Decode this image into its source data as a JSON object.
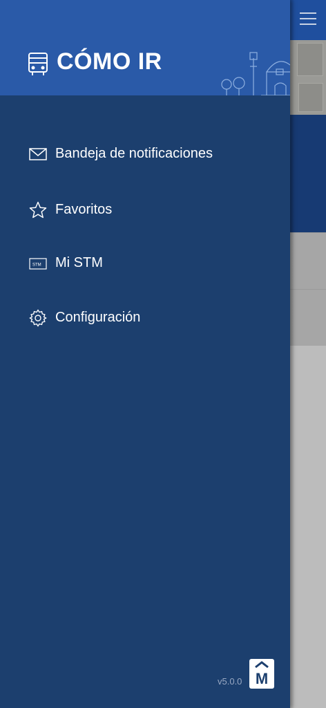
{
  "drawer": {
    "title": "CÓMO IR",
    "items": [
      {
        "label": "Bandeja de notificaciones",
        "icon": "mail-icon"
      },
      {
        "label": "Favoritos",
        "icon": "star-icon"
      },
      {
        "label": "Mi STM",
        "icon": "stm-card-icon"
      },
      {
        "label": "Configuración",
        "icon": "gear-icon"
      }
    ],
    "version": "v5.0.0",
    "card_text": "STM",
    "logo_letter": "M"
  },
  "colors": {
    "header": "#2a5aa8",
    "drawer": "#1c3f6e",
    "text": "#ffffff"
  }
}
